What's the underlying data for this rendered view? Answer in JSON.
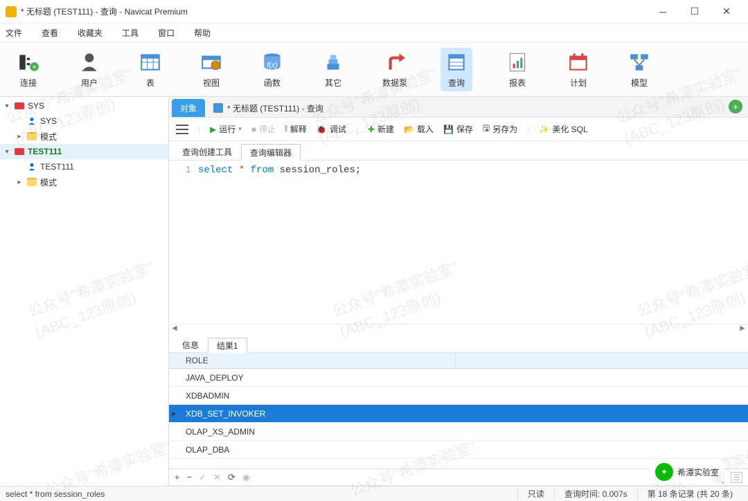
{
  "window": {
    "title": "* 无标题 (TEST111) - 查询 - Navicat Premium"
  },
  "menubar": [
    "文件",
    "查看",
    "收藏夹",
    "工具",
    "窗口",
    "帮助"
  ],
  "toolbar": [
    {
      "label": "连接",
      "name": "tool-connection"
    },
    {
      "label": "用户",
      "name": "tool-user"
    },
    {
      "label": "表",
      "name": "tool-table"
    },
    {
      "label": "视图",
      "name": "tool-view"
    },
    {
      "label": "函数",
      "name": "tool-function"
    },
    {
      "label": "其它",
      "name": "tool-other"
    },
    {
      "label": "数据泵",
      "name": "tool-datapump"
    },
    {
      "label": "查询",
      "name": "tool-query",
      "active": true
    },
    {
      "label": "报表",
      "name": "tool-report"
    },
    {
      "label": "计划",
      "name": "tool-schedule"
    },
    {
      "label": "模型",
      "name": "tool-model"
    }
  ],
  "tree": [
    {
      "depth": 0,
      "arrow": "▾",
      "icon": "db",
      "label": "SYS",
      "bold": false
    },
    {
      "depth": 1,
      "arrow": "",
      "icon": "user",
      "label": "SYS"
    },
    {
      "depth": 1,
      "arrow": "▸",
      "icon": "folder",
      "label": "模式"
    },
    {
      "depth": 0,
      "arrow": "▾",
      "icon": "db",
      "label": "TEST111",
      "bold": true,
      "selected": true
    },
    {
      "depth": 1,
      "arrow": "",
      "icon": "user",
      "label": "TEST111"
    },
    {
      "depth": 1,
      "arrow": "▸",
      "icon": "folder",
      "label": "模式"
    }
  ],
  "doctabs": {
    "active": "对象",
    "inactive": "* 无标题 (TEST111) - 查询"
  },
  "actionbar": {
    "run": "运行",
    "stop": "停止",
    "explain": "解释",
    "debug": "调试",
    "new": "新建",
    "load": "载入",
    "save": "保存",
    "saveas": "另存为",
    "beautify": "美化 SQL"
  },
  "subtabs": {
    "builder": "查询创建工具",
    "editor": "查询编辑器"
  },
  "code": {
    "line_no": "1",
    "kw_select": "select",
    "star": "*",
    "kw_from": "from",
    "ident": "session_roles",
    "semi": ";"
  },
  "result_tabs": {
    "info": "信息",
    "result1": "结果1"
  },
  "result": {
    "header": "ROLE",
    "rows": [
      {
        "value": "JAVA_DEPLOY"
      },
      {
        "value": "XDBADMIN"
      },
      {
        "value": "XDB_SET_INVOKER",
        "selected": true
      },
      {
        "value": "OLAP_XS_ADMIN"
      },
      {
        "value": "OLAP_DBA"
      }
    ]
  },
  "nav_icons": [
    "+",
    "−",
    "✓",
    "✕",
    "⟳",
    "◉"
  ],
  "statusbar": {
    "query": "select * from session_roles",
    "readonly": "只读",
    "elapsed": "查询时间: 0.007s",
    "records": "第 18 条记录 (共 20 条)"
  },
  "watermark": {
    "line1": "公众号\"希潭实验室\"",
    "line2": "(ABC_123原创)"
  },
  "wechat_label": "希潭实验室"
}
